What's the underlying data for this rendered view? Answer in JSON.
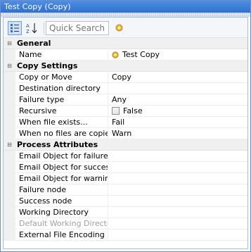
{
  "window": {
    "title": "Test Copy (Copy)"
  },
  "toolbar": {
    "categorized_icon": "categorized-icon",
    "alphabetical_icon": "sort-alphabetical-icon",
    "search_placeholder": "Quick Search",
    "help_icon": "lightbulb-icon"
  },
  "sections": {
    "general": {
      "title": "General",
      "rows": {
        "name": {
          "label": "Name",
          "value": "Test Copy"
        }
      }
    },
    "copy": {
      "title": "Copy Settings",
      "rows": {
        "copy_or_move": {
          "label": "Copy or Move",
          "value": "Copy"
        },
        "destination": {
          "label": "Destination directory",
          "value": ""
        },
        "failure_type": {
          "label": "Failure type",
          "value": "Any"
        },
        "recursive": {
          "label": "Recursive",
          "value": "False"
        },
        "when_exists": {
          "label": "When file exists...",
          "value": "Fail"
        },
        "no_files": {
          "label": "When no files are copied:",
          "value": "Warn"
        }
      }
    },
    "process": {
      "title": "Process Attributes",
      "rows": {
        "email_failure": {
          "label": "Email Object for failure",
          "value": ""
        },
        "email_success": {
          "label": "Email Object for success",
          "value": ""
        },
        "email_warning": {
          "label": "Email Object for warning",
          "value": ""
        },
        "failure_node": {
          "label": "Failure node",
          "value": ""
        },
        "success_node": {
          "label": "Success node",
          "value": ""
        },
        "working_dir": {
          "label": "Working Directory",
          "value": ""
        },
        "default_working_dir": {
          "label": "Default Working Directory",
          "value": ""
        },
        "encoding": {
          "label": "External File Encoding",
          "value": ""
        }
      }
    }
  },
  "colors": {
    "title_bar": "#2f6fd2",
    "selected_button": "#cfe2fb",
    "disabled_text": "#a0a0a0"
  }
}
